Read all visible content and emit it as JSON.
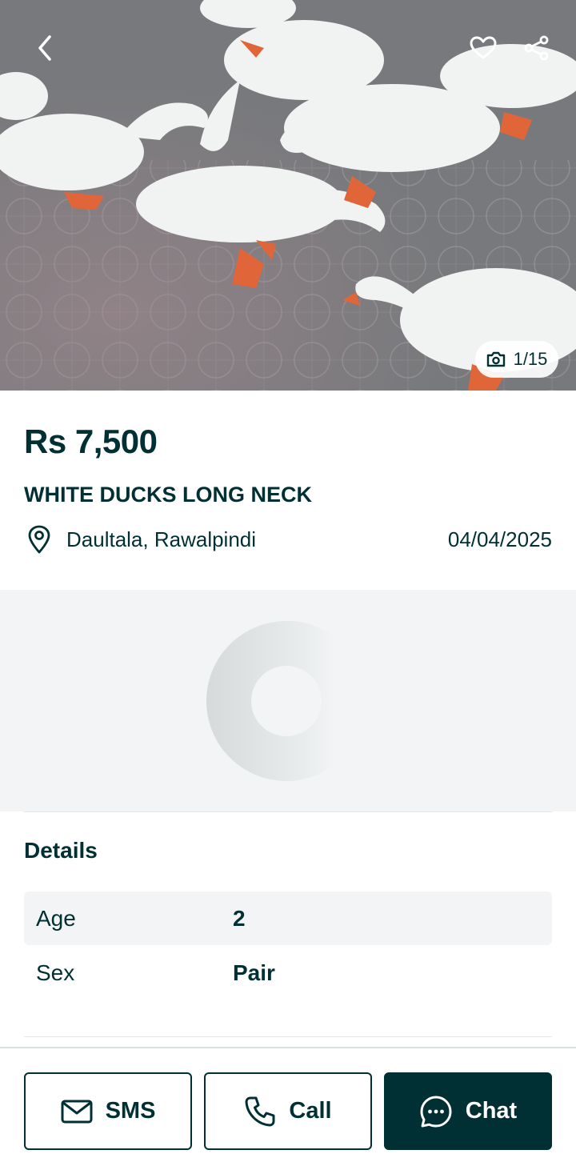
{
  "gallery": {
    "counter": "1/15",
    "icons": {
      "back": "chevron-left-icon",
      "favorite": "heart-outline-icon",
      "share": "share-icon",
      "camera": "camera-icon"
    }
  },
  "listing": {
    "price": "Rs 7,500",
    "title": "WHITE DUCKS LONG NECK",
    "location": "Daultala, Rawalpindi",
    "date": "04/04/2025",
    "location_icon": "map-pin-icon"
  },
  "details": {
    "heading": "Details",
    "rows": [
      {
        "label": "Age",
        "value": "2"
      },
      {
        "label": "Sex",
        "value": "Pair"
      }
    ]
  },
  "actions": {
    "sms": {
      "label": "SMS",
      "icon": "mail-icon"
    },
    "call": {
      "label": "Call",
      "icon": "phone-icon"
    },
    "chat": {
      "label": "Chat",
      "icon": "chat-bubble-icon"
    }
  },
  "colors": {
    "primary": "#002f34",
    "surface": "#f2f4f5",
    "background": "#ffffff"
  }
}
